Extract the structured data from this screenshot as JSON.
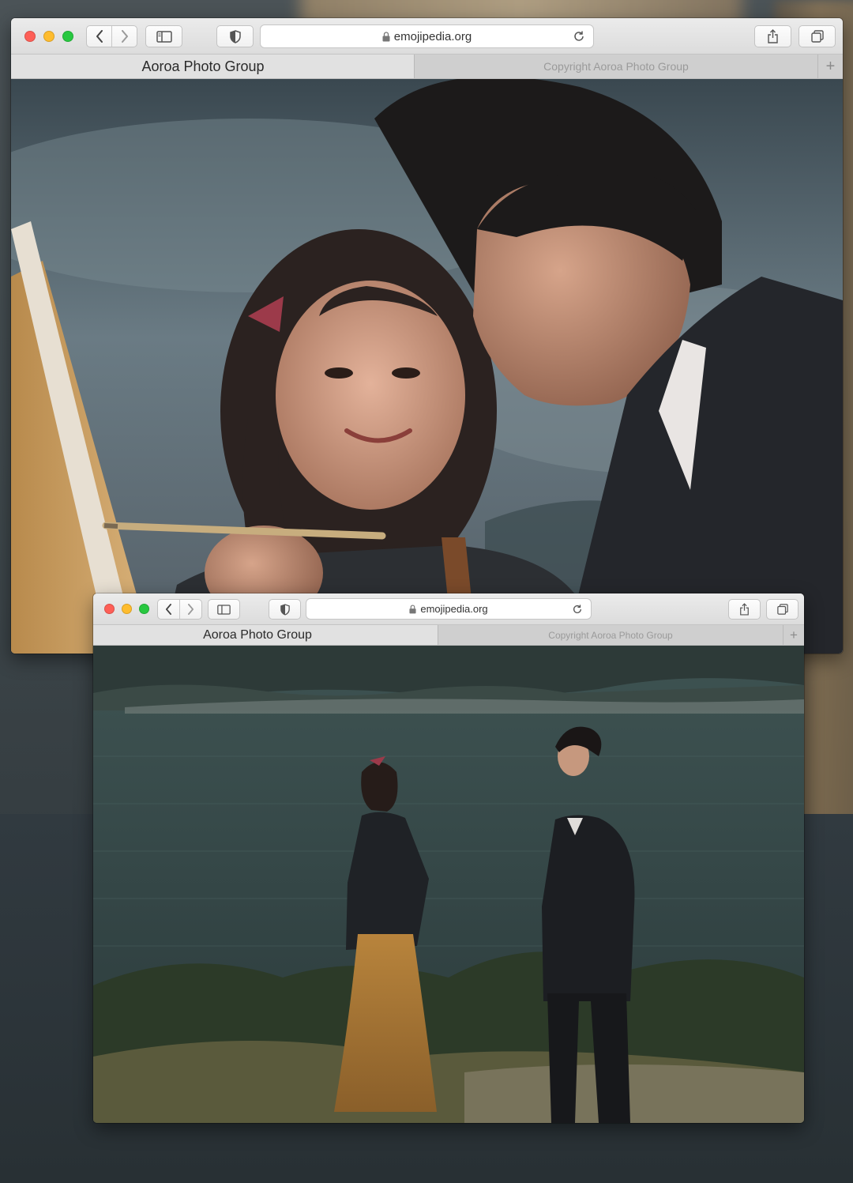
{
  "windows": [
    {
      "url": "emojipedia.org",
      "tabs": [
        {
          "label": "Aoroa Photo Group",
          "active": true
        },
        {
          "label": "Copyright Aoroa Photo Group",
          "active": false
        }
      ],
      "new_tab_label": "+",
      "photo": "close-up of smiling woman with red hair bow painting on canvas, man in dark suit beside her, cloudy sky"
    },
    {
      "url": "emojipedia.org",
      "tabs": [
        {
          "label": "Aoroa Photo Group",
          "active": true
        },
        {
          "label": "Copyright Aoroa Photo Group",
          "active": false
        }
      ],
      "new_tab_label": "+",
      "photo": "woman in mustard tulle skirt and dark blazer, man in dark suit, standing by a lake with town on far shore and grass foreground"
    }
  ],
  "icons": {
    "back": "chevron-left-icon",
    "forward": "chevron-right-icon",
    "sidebar": "sidebar-icon",
    "privacy": "shield-icon",
    "lock": "lock-icon",
    "reload": "reload-icon",
    "share": "share-icon",
    "tabs": "tabs-overview-icon"
  },
  "colors": {
    "close": "#fe5f57",
    "minimize": "#febc2e",
    "maximize": "#28c840"
  }
}
